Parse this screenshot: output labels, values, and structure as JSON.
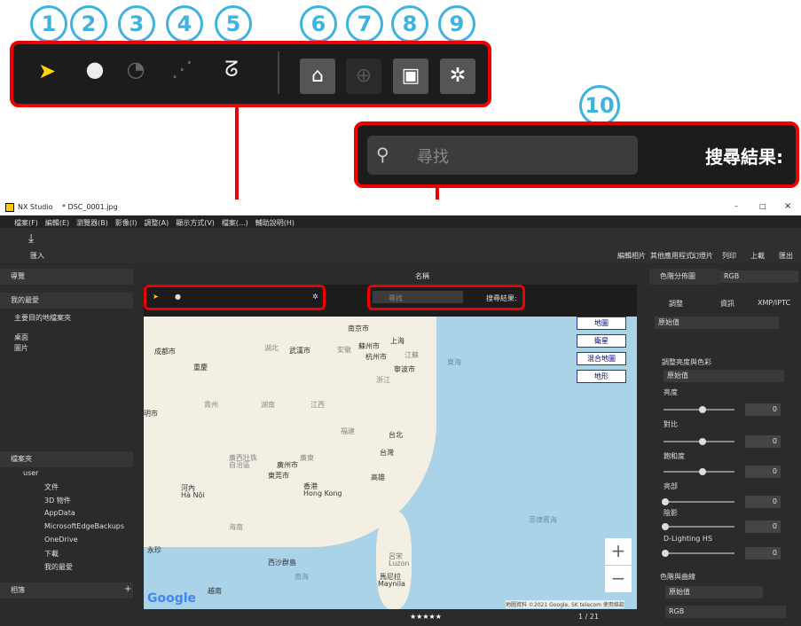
{
  "callouts": [
    "1",
    "2",
    "3",
    "4",
    "5",
    "6",
    "7",
    "8",
    "9",
    "10"
  ],
  "search": {
    "placeholder": "尋找",
    "results_label": "搜尋結果:"
  },
  "window": {
    "app": "NX Studio",
    "file": "* DSC_0001.jpg",
    "min": "–",
    "max": "□",
    "close": "×"
  },
  "menu": [
    "檔案(F)",
    "編輯(E)",
    "瀏覽器(B)",
    "影像(I)",
    "調整(A)",
    "顯示方式(V)",
    "檔案(...)",
    "輔助說明(H)"
  ],
  "toolbar": {
    "import": "匯入",
    "right": [
      "編輯相片",
      "其他應用程式",
      "幻燈片",
      "列印",
      "上載",
      "匯出"
    ]
  },
  "left": {
    "nav": "導覽",
    "favorites": "我的最愛",
    "fav_items": [
      "主要目的地檔案夾",
      "桌面",
      "圖片"
    ],
    "folders": "檔案夾",
    "tree": [
      "user",
      "文件",
      "3D 物件",
      "AppData",
      "MicrosoftEdgeBackups",
      "OneDrive",
      "下載",
      "我的最愛"
    ],
    "albums": "相簿",
    "add": "+"
  },
  "center": {
    "sort": "名稱",
    "page": "1 / 21",
    "map_attr": "地圖資料 ©2021 Google, SK telecom  使用條款"
  },
  "map": {
    "type_buttons": [
      "地圖",
      "衛星",
      "混合地圖",
      "地形"
    ],
    "labels": [
      "南京市",
      "上海",
      "蘇州市",
      "杭州市",
      "寧波市",
      "武漢市",
      "湖北",
      "成都市",
      "重慶",
      "浙江",
      "江西",
      "湖南",
      "貴州",
      "福建",
      "台北",
      "台灣",
      "高雄",
      "廣州市",
      "東莞市",
      "香港",
      "Hong Kong",
      "河內",
      "Hà Nội",
      "海南",
      "永珍",
      "西沙群島",
      "呂宋",
      "Luzon",
      "馬尼拉",
      "Maynila",
      "越南",
      "東海",
      "菲律賓海",
      "南海",
      "明市",
      "江蘇",
      "安徽",
      "廣東",
      "自治區",
      "廣西壯族"
    ],
    "zoom_in": "+",
    "zoom_out": "−",
    "google": "Google"
  },
  "right": {
    "histogram": "色階分佈圖",
    "histogram_mode": "RGB",
    "tabs": [
      "調整",
      "資訊",
      "XMP/IPTC"
    ],
    "preset": "原始值",
    "section1": "調整亮度與色彩",
    "section1_preset": "原始值",
    "sliders": [
      {
        "label": "亮度",
        "min": "-100",
        "max": "100",
        "value": "0"
      },
      {
        "label": "對比",
        "min": "-100",
        "max": "100",
        "value": "0"
      },
      {
        "label": "飽和度",
        "min": "-100",
        "max": "100",
        "value": "0"
      },
      {
        "label": "亮部",
        "min": "0",
        "max": "100",
        "value": "0"
      },
      {
        "label": "陰影",
        "min": "0",
        "max": "100",
        "value": "0"
      },
      {
        "label": "D-Lighting HS",
        "min": "0",
        "max": "100",
        "value": "0"
      }
    ],
    "section2": "色階與曲線",
    "section2_preset": "原始值",
    "section2_mode": "RGB"
  }
}
